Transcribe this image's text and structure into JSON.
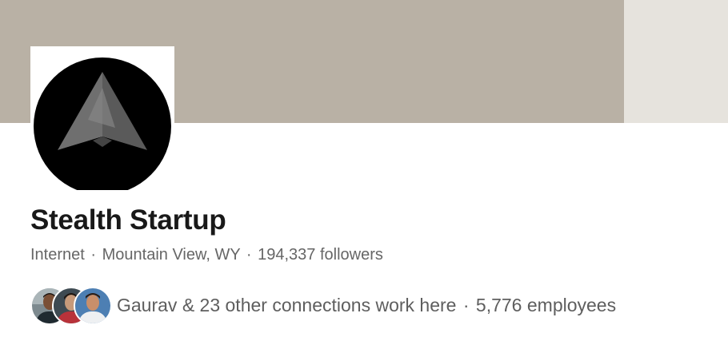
{
  "company": {
    "name": "Stealth Startup",
    "industry": "Internet",
    "location": "Mountain View, WY",
    "followers": "194,337 followers"
  },
  "meta_separator": "·",
  "connections": {
    "text": "Gaurav & 23 other connections work here",
    "employees": "5,776 employees",
    "avatars": [
      {
        "name": "connection-avatar-1"
      },
      {
        "name": "connection-avatar-2"
      },
      {
        "name": "connection-avatar-3"
      }
    ]
  },
  "colors": {
    "cover": "#b9b1a5",
    "cover_side": "#e6e3dd",
    "title": "#191919",
    "meta": "#666666"
  }
}
